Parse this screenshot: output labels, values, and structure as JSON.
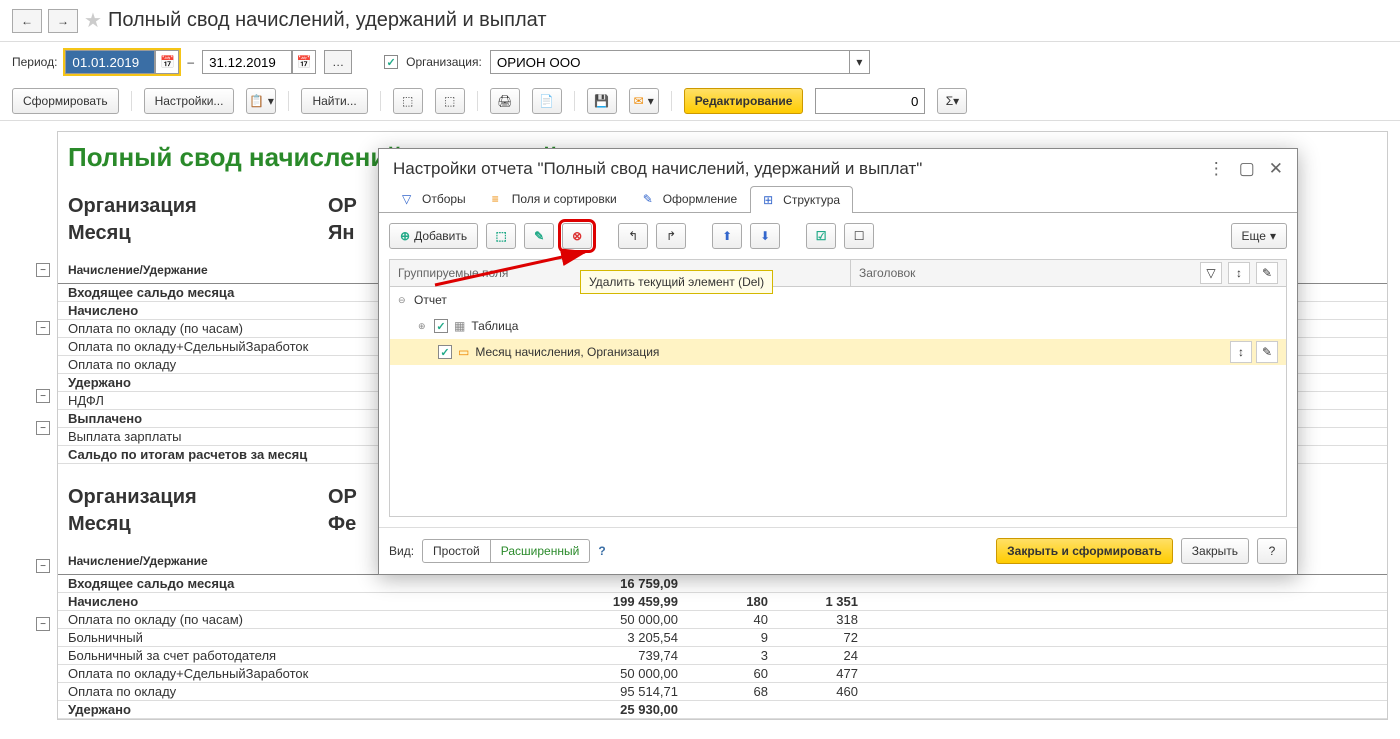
{
  "page": {
    "title": "Полный свод начислений, удержаний и выплат"
  },
  "filter": {
    "period_label": "Период:",
    "date_from": "01.01.2019",
    "date_to": "31.12.2019",
    "dash": "–",
    "org_label": "Организация:",
    "org_value": "ОРИОН ООО"
  },
  "toolbar": {
    "generate": "Сформировать",
    "settings": "Настройки...",
    "find": "Найти...",
    "edit_mode": "Редактирование",
    "num_value": "0"
  },
  "report": {
    "title": "Полный свод начислений, удержаний и выплат",
    "org_label": "Организация",
    "org_value": "ОР",
    "month_label": "Месяц",
    "month_value1": "Ян",
    "month_value2": "Фе",
    "table_header": "Начисление/Удержание",
    "sec1": [
      {
        "name": "Входящее сальдо месяца",
        "bold": true
      },
      {
        "name": "Начислено",
        "bold": true
      },
      {
        "name": "Оплата по окладу (по часам)"
      },
      {
        "name": "Оплата по окладу+СдельныйЗаработок"
      },
      {
        "name": "Оплата по окладу"
      },
      {
        "name": "Удержано",
        "bold": true
      },
      {
        "name": "НДФЛ"
      },
      {
        "name": "Выплачено",
        "bold": true
      },
      {
        "name": "Выплата зарплаты"
      },
      {
        "name": "Сальдо по итогам расчетов за месяц",
        "bold": true
      }
    ],
    "sec2": [
      {
        "name": "Входящее сальдо месяца",
        "bold": true,
        "v1": "16 759,09"
      },
      {
        "name": "Начислено",
        "bold": true,
        "v1": "199 459,99",
        "v2": "180",
        "v3": "1 351"
      },
      {
        "name": "Оплата по окладу (по часам)",
        "v1": "50 000,00",
        "v2": "40",
        "v3": "318"
      },
      {
        "name": "Больничный",
        "v1": "3 205,54",
        "v2": "9",
        "v3": "72"
      },
      {
        "name": "Больничный за счет работодателя",
        "v1": "739,74",
        "v2": "3",
        "v3": "24"
      },
      {
        "name": "Оплата по окладу+СдельныйЗаработок",
        "v1": "50 000,00",
        "v2": "60",
        "v3": "477"
      },
      {
        "name": "Оплата по окладу",
        "v1": "95 514,71",
        "v2": "68",
        "v3": "460"
      },
      {
        "name": "Удержано",
        "bold": true,
        "v1": "25 930,00"
      }
    ]
  },
  "dialog": {
    "title": "Настройки отчета \"Полный свод начислений, удержаний и выплат\"",
    "tabs": {
      "filters": "Отборы",
      "fields": "Поля и сортировки",
      "format": "Оформление",
      "structure": "Структура"
    },
    "add": "Добавить",
    "more": "Еще",
    "tooltip": "Удалить текущий элемент (Del)",
    "grid_col1": "Группируемые поля",
    "grid_col2": "Заголовок",
    "tree": {
      "root": "Отчет",
      "table": "Таблица",
      "fields": "Месяц начисления, Организация"
    },
    "view_label": "Вид:",
    "mode_simple": "Простой",
    "mode_advanced": "Расширенный",
    "close_generate": "Закрыть и сформировать",
    "close": "Закрыть"
  }
}
